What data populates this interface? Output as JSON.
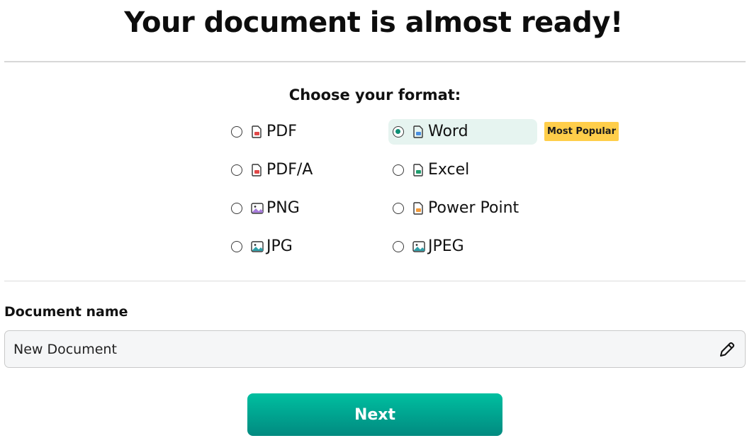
{
  "title": "Your document is almost ready!",
  "format_section": {
    "label": "Choose your format:",
    "options": [
      {
        "label": "PDF",
        "icon": "pdf-file-icon",
        "selected": false
      },
      {
        "label": "Word",
        "icon": "word-file-icon",
        "selected": true,
        "badge": "Most Popular"
      },
      {
        "label": "PDF/A",
        "icon": "pdf-file-icon",
        "selected": false
      },
      {
        "label": "Excel",
        "icon": "excel-file-icon",
        "selected": false
      },
      {
        "label": "PNG",
        "icon": "image-file-icon",
        "selected": false
      },
      {
        "label": "Power Point",
        "icon": "powerpoint-file-icon",
        "selected": false
      },
      {
        "label": "JPG",
        "icon": "image-file-icon",
        "selected": false
      },
      {
        "label": "JPEG",
        "icon": "image-file-icon",
        "selected": false
      }
    ],
    "selected_highlight_color": "#e6f4f0",
    "badge_color": "#ffce4a"
  },
  "document_name": {
    "label": "Document name",
    "value": "New Document",
    "edit_icon": "pencil-icon"
  },
  "next_button": {
    "label": "Next",
    "color": "#00a98f"
  }
}
